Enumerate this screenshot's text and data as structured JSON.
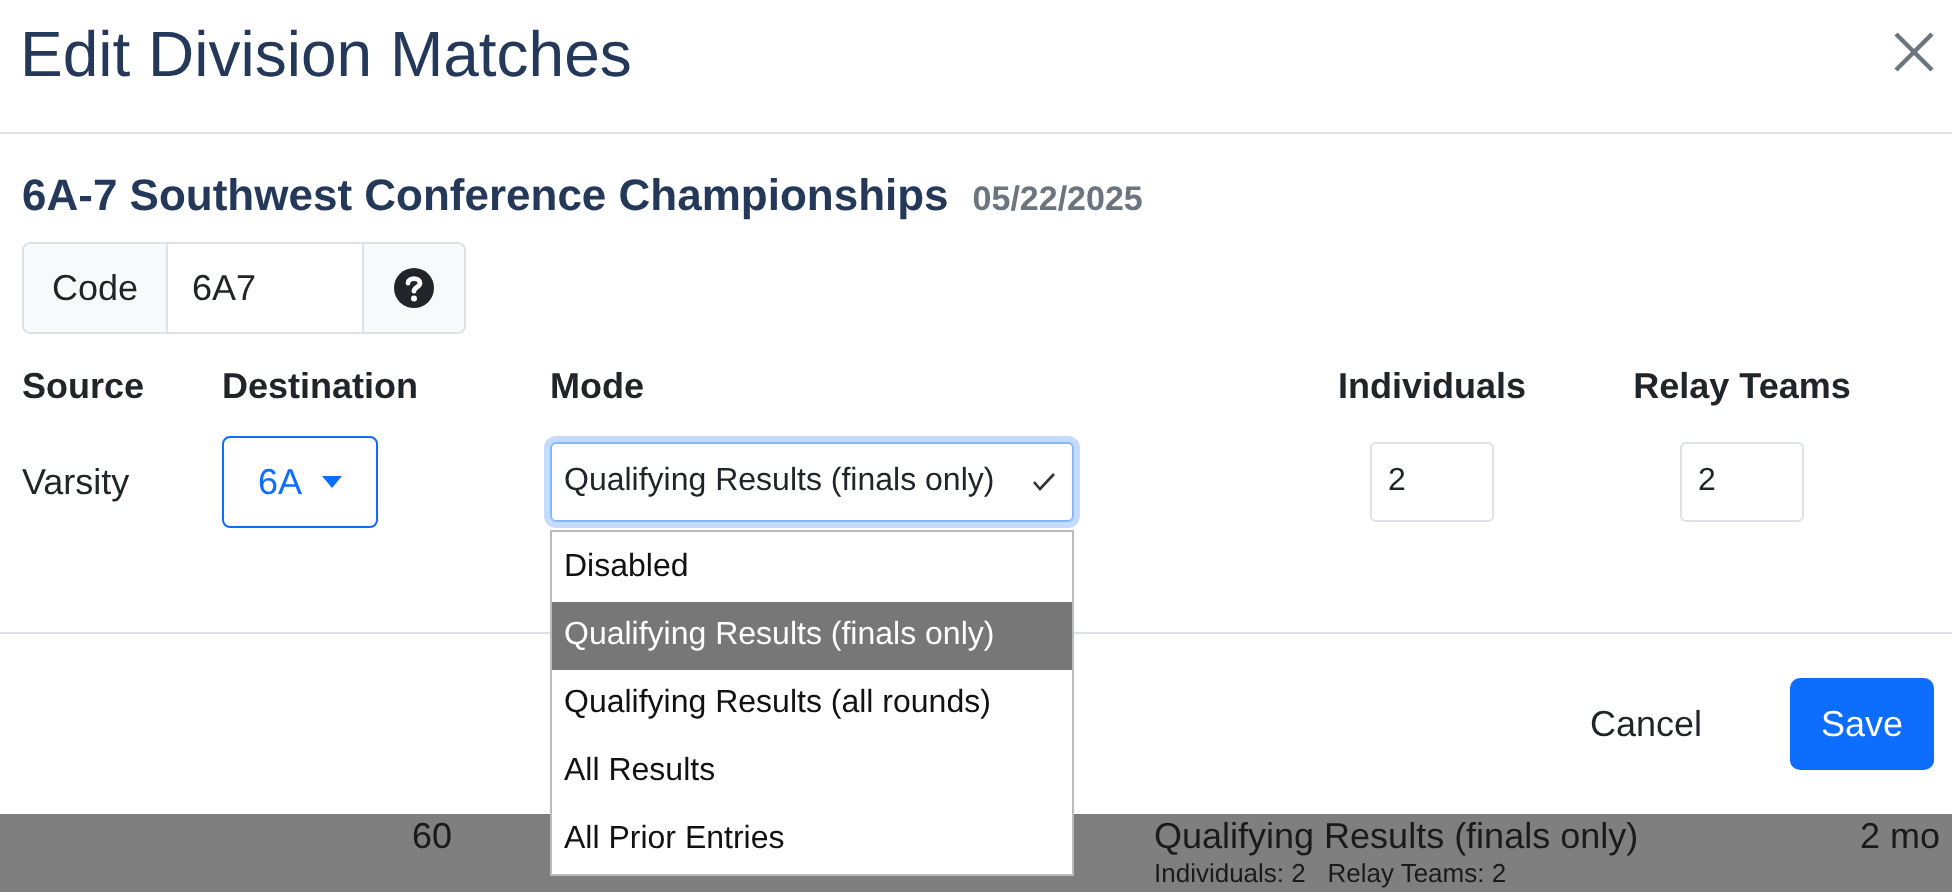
{
  "dialog": {
    "title": "Edit Division Matches",
    "meet": {
      "name": "6A-7 Southwest Conference Championships",
      "date": "05/22/2025"
    },
    "code": {
      "label": "Code",
      "value": "6A7"
    },
    "columns": [
      "Source",
      "Destination",
      "Mode",
      "Individuals",
      "Relay Teams"
    ],
    "row": {
      "source": "Varsity",
      "destination": "6A",
      "mode": "Qualifying Results (finals only)",
      "individuals": "2",
      "relay_teams": "2"
    },
    "mode_options": [
      {
        "label": "Disabled",
        "selected": false
      },
      {
        "label": "Qualifying Results (finals only)",
        "selected": true
      },
      {
        "label": "Qualifying Results (all rounds)",
        "selected": false
      },
      {
        "label": "All Results",
        "selected": false
      },
      {
        "label": "All Prior Entries",
        "selected": false
      }
    ],
    "buttons": [
      {
        "label": "Cancel",
        "kind": "secondary"
      },
      {
        "label": "Save",
        "kind": "primary"
      }
    ]
  },
  "background_row": {
    "column_1": "60",
    "column_2": "Qualifying Results (finals only)",
    "column_3": "2 mo",
    "detail": "Individuals: 2   Relay Teams: 2"
  }
}
